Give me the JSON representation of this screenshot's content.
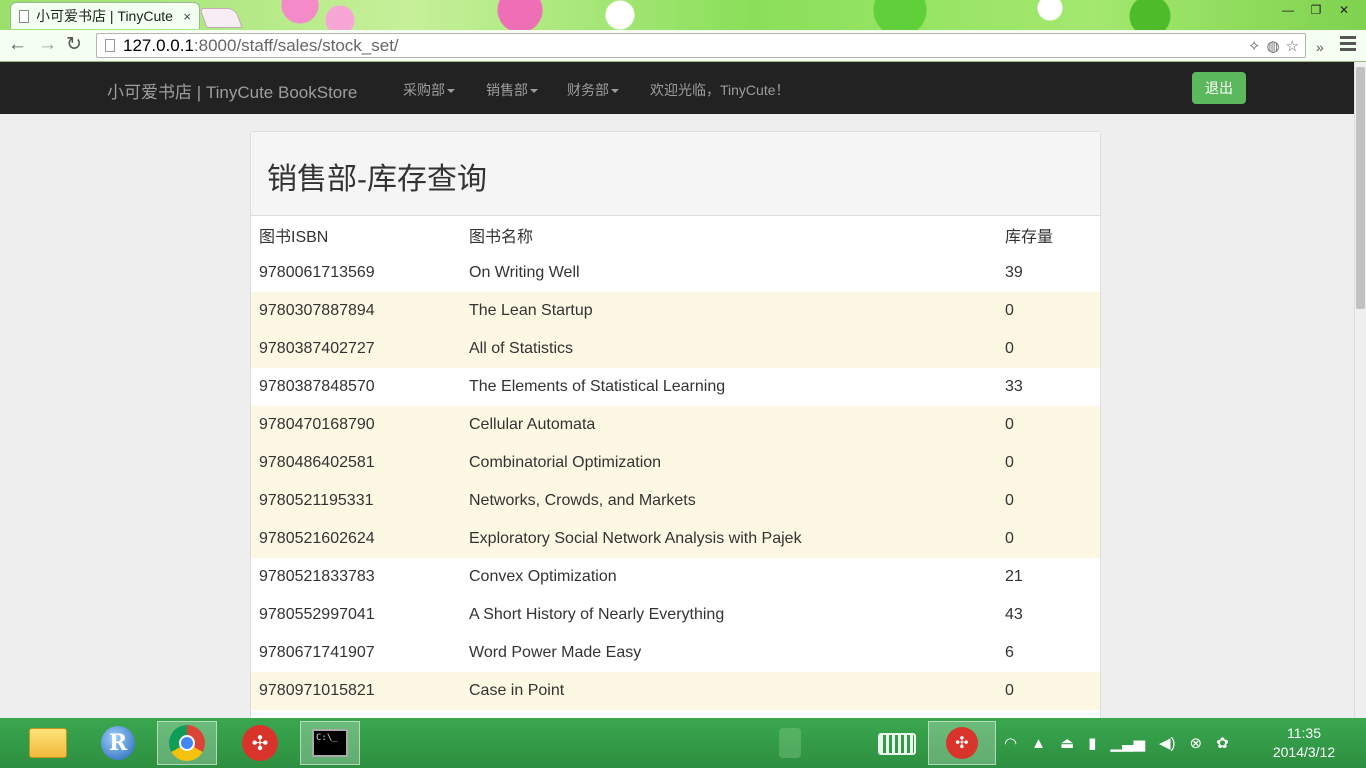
{
  "browser": {
    "tab_title": "小可爱书店 | TinyCute BookStore",
    "tab_close": "×",
    "url_host": "127.0.0.1",
    "url_rest": ":8000/staff/sales/stock_set/",
    "back": "←",
    "forward": "→",
    "reload": "↻",
    "window_minimize": "—",
    "window_restore": "❐",
    "window_close": "✕",
    "overflow": "»"
  },
  "navbar": {
    "brand": "小可爱书店 | TinyCute BookStore",
    "items": [
      {
        "label": "采购部"
      },
      {
        "label": "销售部"
      },
      {
        "label": "财务部"
      }
    ],
    "welcome": "欢迎光临，TinyCute！",
    "logout": "退出"
  },
  "panel": {
    "title": "销售部-库存查询"
  },
  "table": {
    "headers": [
      "图书ISBN",
      "图书名称",
      "库存量"
    ],
    "rows": [
      {
        "isbn": "9780061713569",
        "name": "On Writing Well",
        "stock": "39"
      },
      {
        "isbn": "9780307887894",
        "name": "The Lean Startup",
        "stock": "0"
      },
      {
        "isbn": "9780387402727",
        "name": "All of Statistics",
        "stock": "0"
      },
      {
        "isbn": "9780387848570",
        "name": "The Elements of Statistical Learning",
        "stock": "33"
      },
      {
        "isbn": "9780470168790",
        "name": "Cellular Automata",
        "stock": "0"
      },
      {
        "isbn": "9780486402581",
        "name": "Combinatorial Optimization",
        "stock": "0"
      },
      {
        "isbn": "9780521195331",
        "name": "Networks, Crowds, and Markets",
        "stock": "0"
      },
      {
        "isbn": "9780521602624",
        "name": "Exploratory Social Network Analysis with Pajek",
        "stock": "0"
      },
      {
        "isbn": "9780521833783",
        "name": "Convex Optimization",
        "stock": "21"
      },
      {
        "isbn": "9780552997041",
        "name": "A Short History of Nearly Everything",
        "stock": "43"
      },
      {
        "isbn": "9780671741907",
        "name": "Word Power Made Easy",
        "stock": "6"
      },
      {
        "isbn": "9780971015821",
        "name": "Case in Point",
        "stock": "0"
      }
    ]
  },
  "taskbar": {
    "r_label": "R",
    "cmd_label": "C:\\_",
    "time": "11:35",
    "date": "2014/3/12"
  }
}
